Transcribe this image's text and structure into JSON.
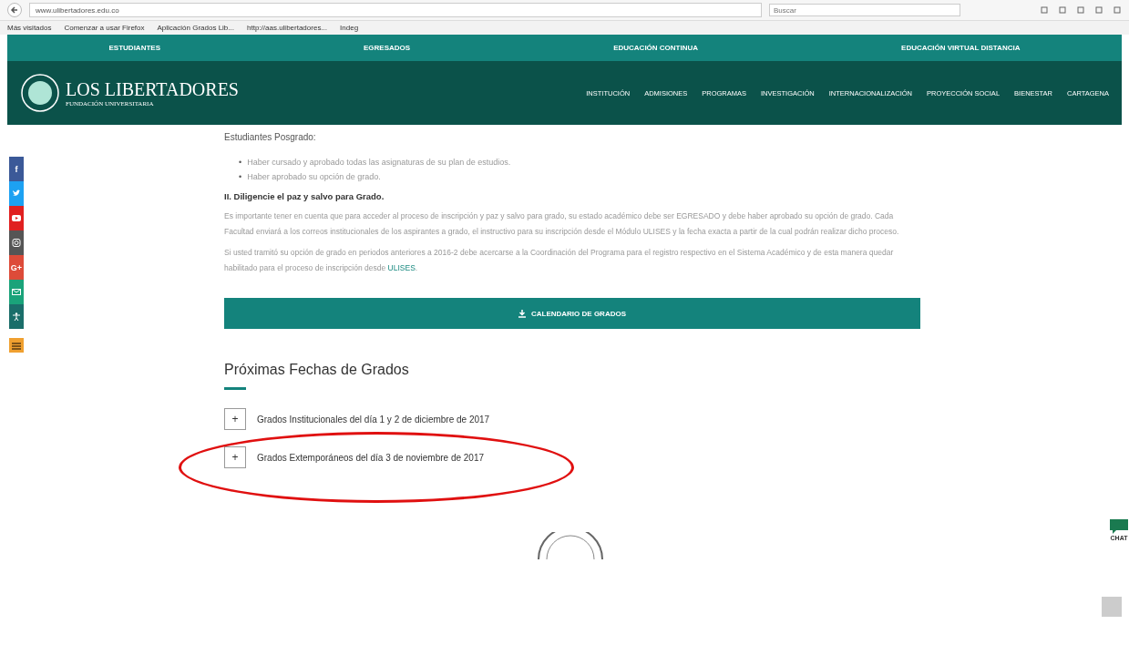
{
  "browser": {
    "url": "www.ulibertadores.edu.co",
    "search_placeholder": "Buscar",
    "bookmarks": [
      "Más visitados",
      "Comenzar a usar Firefox",
      "Aplicación Grados Lib...",
      "http://aas.ulibertadores...",
      "Indeg"
    ]
  },
  "top_nav": [
    "ESTUDIANTES",
    "EGRESADOS",
    "EDUCACIÓN CONTINUA",
    "EDUCACIÓN VIRTUAL DISTANCIA"
  ],
  "logo": {
    "name": "LOS LIBERTADORES",
    "subtitle": "FUNDACIÓN UNIVERSITARIA"
  },
  "main_nav": [
    "INSTITUCIÓN",
    "ADMISIONES",
    "PROGRAMAS",
    "INVESTIGACIÓN",
    "INTERNACIONALIZACIÓN",
    "PROYECCIÓN SOCIAL",
    "BIENESTAR",
    "CARTAGENA"
  ],
  "social": [
    {
      "kind": "facebook",
      "glyph": "f",
      "color": "#3b5998"
    },
    {
      "kind": "twitter",
      "color": "#1da1f2"
    },
    {
      "kind": "youtube",
      "color": "#e02020"
    },
    {
      "kind": "instagram",
      "color": "#555555"
    },
    {
      "kind": "googleplus",
      "glyph": "G+",
      "color": "#dd4b39"
    },
    {
      "kind": "mail",
      "color": "#1aa37a"
    },
    {
      "kind": "accessibility",
      "color": "#1a6e6a"
    },
    {
      "kind": "other",
      "color": "#f0a030"
    }
  ],
  "content": {
    "subheading": "Estudiantes Posgrado:",
    "bullets": [
      {
        "marker": "•",
        "text": "Haber cursado y aprobado todas las asignaturas de su plan de estudios."
      },
      {
        "marker": "•",
        "text": "Haber aprobado su opción de grado."
      }
    ],
    "step": "II. Diligencie el paz y salvo para Grado.",
    "paragraphs": [
      {
        "text": "Es importante tener en cuenta que para acceder al proceso de inscripción y paz y salvo para grado, su estado académico debe ser EGRESADO y debe haber aprobado su opción de grado. Cada Facultad enviará a los correos institucionales de los aspirantes a grado, el instructivo para su inscripción desde el Módulo ULISES y la fecha exacta a partir de la cual podrán realizar dicho proceso."
      },
      {
        "text": "Si usted tramitó su opción de grado en periodos anteriores a 2016-2 debe acercarse a la Coordinación del Programa para el registro respectivo en el Sistema Académico y de esta manera quedar habilitado para el proceso de inscripción desde",
        "link": "ULISES",
        "end": "."
      }
    ],
    "button": "CALENDARIO DE GRADOS",
    "dates_heading": "Próximas Fechas de Grados",
    "accordion": [
      {
        "toggle": "+",
        "label": "Grados Institucionales del día 1 y 2 de diciembre de 2017",
        "expanded": false,
        "circled": false
      },
      {
        "toggle": "+",
        "label": "Grados Extemporáneos del día 3 de noviembre de 2017",
        "expanded": false,
        "circled": true
      }
    ]
  },
  "chat": {
    "label": "CHAT"
  }
}
